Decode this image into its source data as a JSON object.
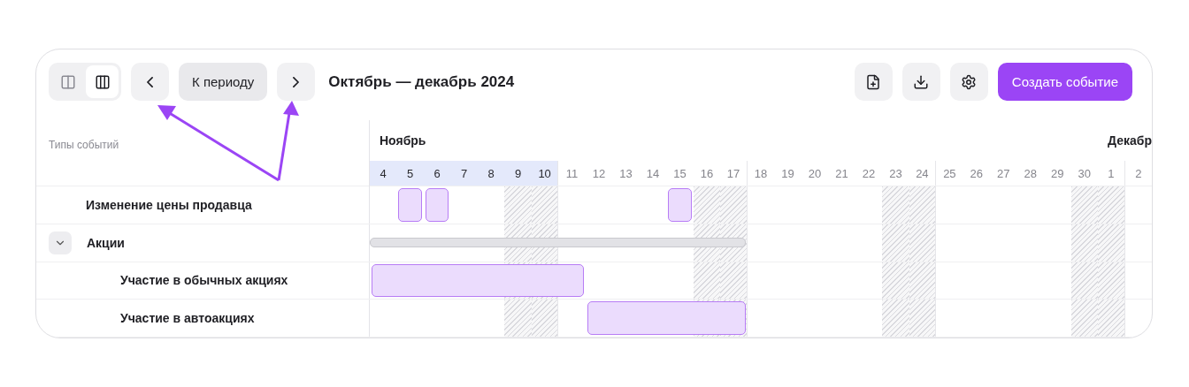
{
  "toolbar": {
    "view_toggle": [
      {
        "kind": "two-columns",
        "selected": false
      },
      {
        "kind": "three-columns",
        "selected": true
      }
    ],
    "period_button": "К периоду",
    "title": "Октябрь — декабрь 2024",
    "actions": [
      {
        "kind": "new-file"
      },
      {
        "kind": "download"
      },
      {
        "kind": "settings"
      }
    ],
    "create_button": "Создать событие"
  },
  "timeline": {
    "column_header": "Типы событий",
    "days": [
      {
        "label": "4",
        "month_label": "Ноябрь",
        "selected": true,
        "weekend": false,
        "week_end": false
      },
      {
        "label": "5",
        "selected": true,
        "weekend": false,
        "week_end": false
      },
      {
        "label": "6",
        "selected": true,
        "weekend": false,
        "week_end": false
      },
      {
        "label": "7",
        "selected": true,
        "weekend": false,
        "week_end": false
      },
      {
        "label": "8",
        "selected": true,
        "weekend": false,
        "week_end": false
      },
      {
        "label": "9",
        "selected": true,
        "weekend": true,
        "week_end": false
      },
      {
        "label": "10",
        "selected": true,
        "weekend": true,
        "week_end": true
      },
      {
        "label": "11",
        "selected": false,
        "weekend": false,
        "week_end": false
      },
      {
        "label": "12",
        "selected": false,
        "weekend": false,
        "week_end": false
      },
      {
        "label": "13",
        "selected": false,
        "weekend": false,
        "week_end": false
      },
      {
        "label": "14",
        "selected": false,
        "weekend": false,
        "week_end": false
      },
      {
        "label": "15",
        "selected": false,
        "weekend": false,
        "week_end": false
      },
      {
        "label": "16",
        "selected": false,
        "weekend": true,
        "week_end": false
      },
      {
        "label": "17",
        "selected": false,
        "weekend": true,
        "week_end": true
      },
      {
        "label": "18",
        "selected": false,
        "weekend": false,
        "week_end": false
      },
      {
        "label": "19",
        "selected": false,
        "weekend": false,
        "week_end": false
      },
      {
        "label": "20",
        "selected": false,
        "weekend": false,
        "week_end": false
      },
      {
        "label": "21",
        "selected": false,
        "weekend": false,
        "week_end": false
      },
      {
        "label": "22",
        "selected": false,
        "weekend": false,
        "week_end": false
      },
      {
        "label": "23",
        "selected": false,
        "weekend": true,
        "week_end": false
      },
      {
        "label": "24",
        "selected": false,
        "weekend": true,
        "week_end": true
      },
      {
        "label": "25",
        "selected": false,
        "weekend": false,
        "week_end": false
      },
      {
        "label": "26",
        "selected": false,
        "weekend": false,
        "week_end": false
      },
      {
        "label": "27",
        "selected": false,
        "weekend": false,
        "week_end": false
      },
      {
        "label": "28",
        "selected": false,
        "weekend": false,
        "week_end": false
      },
      {
        "label": "29",
        "selected": false,
        "weekend": false,
        "week_end": false
      },
      {
        "label": "30",
        "selected": false,
        "weekend": true,
        "week_end": false
      },
      {
        "label": "1",
        "month_label": "Декабр",
        "selected": false,
        "weekend": true,
        "week_end": true
      },
      {
        "label": "2",
        "selected": false,
        "weekend": false,
        "week_end": false
      }
    ],
    "rows": [
      {
        "label": "Изменение цены продавца",
        "kind": "event",
        "cells": [
          {
            "kind": "none"
          },
          {
            "kind": "single"
          },
          {
            "kind": "single"
          },
          {
            "kind": "none"
          },
          {
            "kind": "none"
          },
          {
            "kind": "none"
          },
          {
            "kind": "none"
          },
          {
            "kind": "none"
          },
          {
            "kind": "none"
          },
          {
            "kind": "none"
          },
          {
            "kind": "none"
          },
          {
            "kind": "single"
          },
          {
            "kind": "none"
          },
          {
            "kind": "none"
          },
          {
            "kind": "none"
          },
          {
            "kind": "none"
          },
          {
            "kind": "none"
          },
          {
            "kind": "none"
          },
          {
            "kind": "none"
          },
          {
            "kind": "none"
          },
          {
            "kind": "none"
          },
          {
            "kind": "none"
          },
          {
            "kind": "none"
          },
          {
            "kind": "none"
          },
          {
            "kind": "none"
          },
          {
            "kind": "none"
          },
          {
            "kind": "none"
          },
          {
            "kind": "none"
          },
          {
            "kind": "none"
          }
        ]
      },
      {
        "label": "Акции",
        "expanded": true,
        "kind": "group",
        "cells": [
          {
            "kind": "start"
          },
          {
            "kind": "middle"
          },
          {
            "kind": "middle"
          },
          {
            "kind": "middle"
          },
          {
            "kind": "middle"
          },
          {
            "kind": "middle"
          },
          {
            "kind": "middle"
          },
          {
            "kind": "middle"
          },
          {
            "kind": "middle"
          },
          {
            "kind": "middle"
          },
          {
            "kind": "middle"
          },
          {
            "kind": "middle"
          },
          {
            "kind": "middle"
          },
          {
            "kind": "end"
          },
          {
            "kind": "none"
          },
          {
            "kind": "none"
          },
          {
            "kind": "none"
          },
          {
            "kind": "none"
          },
          {
            "kind": "none"
          },
          {
            "kind": "none"
          },
          {
            "kind": "none"
          },
          {
            "kind": "none"
          },
          {
            "kind": "none"
          },
          {
            "kind": "none"
          },
          {
            "kind": "none"
          },
          {
            "kind": "none"
          },
          {
            "kind": "none"
          },
          {
            "kind": "none"
          },
          {
            "kind": "none"
          }
        ],
        "children": [
          {
            "label": "Участие в обычных акциях",
            "kind": "event",
            "cells": [
              {
                "kind": "start"
              },
              {
                "kind": "middle"
              },
              {
                "kind": "middle"
              },
              {
                "kind": "middle"
              },
              {
                "kind": "middle"
              },
              {
                "kind": "middle"
              },
              {
                "kind": "middle"
              },
              {
                "kind": "end"
              },
              {
                "kind": "none"
              },
              {
                "kind": "none"
              },
              {
                "kind": "none"
              },
              {
                "kind": "none"
              },
              {
                "kind": "none"
              },
              {
                "kind": "none"
              },
              {
                "kind": "none"
              },
              {
                "kind": "none"
              },
              {
                "kind": "none"
              },
              {
                "kind": "none"
              },
              {
                "kind": "none"
              },
              {
                "kind": "none"
              },
              {
                "kind": "none"
              },
              {
                "kind": "none"
              },
              {
                "kind": "none"
              },
              {
                "kind": "none"
              },
              {
                "kind": "none"
              },
              {
                "kind": "none"
              },
              {
                "kind": "none"
              },
              {
                "kind": "none"
              },
              {
                "kind": "none"
              }
            ]
          },
          {
            "label": "Участие в автоакциях",
            "kind": "event",
            "cells": [
              {
                "kind": "none"
              },
              {
                "kind": "none"
              },
              {
                "kind": "none"
              },
              {
                "kind": "none"
              },
              {
                "kind": "none"
              },
              {
                "kind": "none"
              },
              {
                "kind": "none"
              },
              {
                "kind": "none"
              },
              {
                "kind": "start"
              },
              {
                "kind": "middle"
              },
              {
                "kind": "middle"
              },
              {
                "kind": "middle"
              },
              {
                "kind": "middle"
              },
              {
                "kind": "end"
              },
              {
                "kind": "none"
              },
              {
                "kind": "none"
              },
              {
                "kind": "none"
              },
              {
                "kind": "none"
              },
              {
                "kind": "none"
              },
              {
                "kind": "none"
              },
              {
                "kind": "none"
              },
              {
                "kind": "none"
              },
              {
                "kind": "none"
              },
              {
                "kind": "none"
              },
              {
                "kind": "none"
              },
              {
                "kind": "none"
              },
              {
                "kind": "none"
              },
              {
                "kind": "none"
              },
              {
                "kind": "none"
              }
            ]
          }
        ]
      }
    ]
  }
}
